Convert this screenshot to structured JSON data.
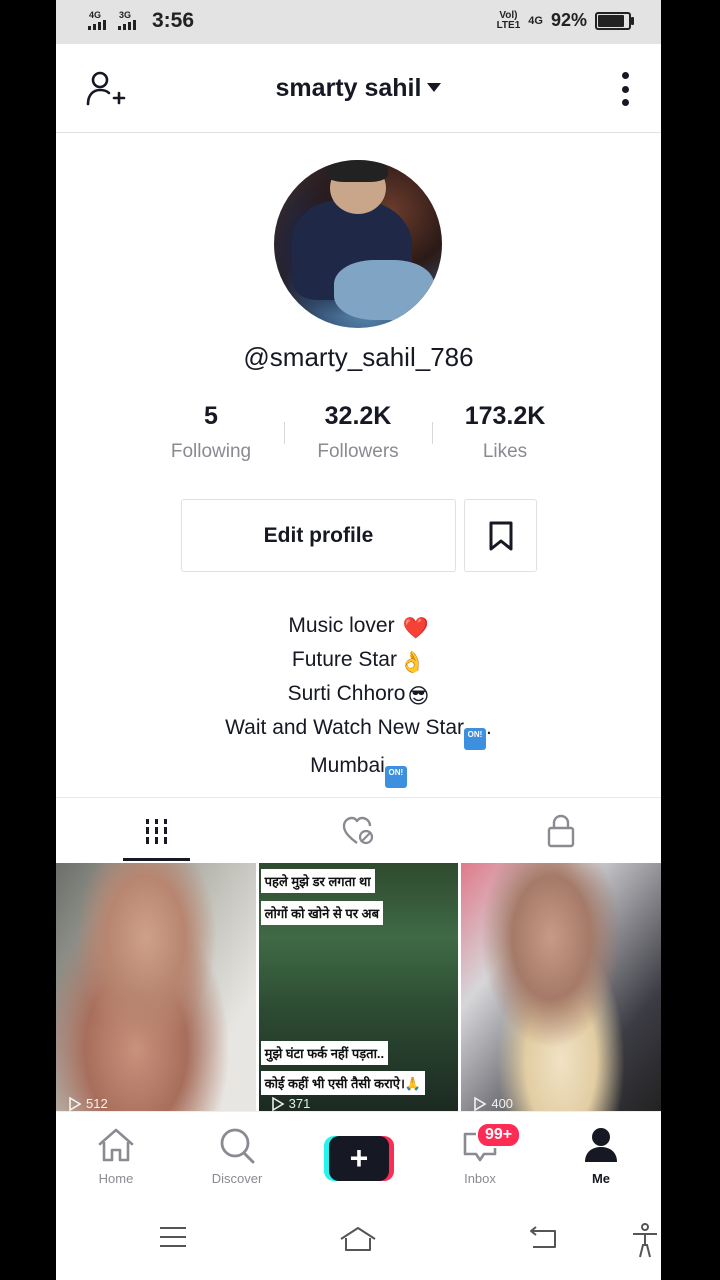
{
  "status_bar": {
    "sim1_network": "4G",
    "sim2_network": "3G",
    "time": "3:56",
    "volte_top": "Vol)",
    "volte_bottom": "LTE1",
    "network_right": "4G",
    "battery_percent_text": "92%",
    "battery_level": 0.92
  },
  "header": {
    "title": "smarty sahil",
    "add_friend_icon": "add-user-icon",
    "more_icon": "vertical-dots-icon"
  },
  "profile": {
    "handle": "@smarty_sahil_786",
    "stats": [
      {
        "value": "5",
        "label": "Following"
      },
      {
        "value": "32.2K",
        "label": "Followers"
      },
      {
        "value": "173.2K",
        "label": "Likes"
      }
    ],
    "edit_button": "Edit profile",
    "bookmark_icon": "bookmark-icon",
    "bio": [
      {
        "text": "Music lover ",
        "emoji": "❤️"
      },
      {
        "text": "Future Star",
        "emoji": "👌"
      },
      {
        "text": "Surti Chhoro",
        "emoji": "😎"
      },
      {
        "text": "Wait and Watch New Star",
        "badge": "ON!",
        "suffix": "."
      },
      {
        "text": "Mumbai",
        "badge": "ON!",
        "suffix": ""
      }
    ],
    "badge_text": "ON!"
  },
  "tabs": [
    {
      "name": "videos-grid-icon",
      "active": true
    },
    {
      "name": "liked-hidden-icon",
      "active": false
    },
    {
      "name": "lock-icon",
      "active": false
    }
  ],
  "videos": [
    {
      "plays": "512",
      "captions": []
    },
    {
      "plays": "371",
      "captions": [
        "पहले मुझे डर लगता था",
        "लोगों को खोने से पर अब",
        "मुझे घंटा फर्क नहीं पड़ता..",
        "कोई कहीं भी एसी तैसी कराऐ।🙏"
      ]
    },
    {
      "plays": "400",
      "captions": []
    }
  ],
  "bottom_nav": {
    "home": "Home",
    "discover": "Discover",
    "create": "+",
    "inbox": "Inbox",
    "inbox_badge": "99+",
    "me": "Me"
  },
  "colors": {
    "text": "#161823",
    "secondary": "#8a8b91",
    "accent_red": "#fe2c55",
    "accent_cyan": "#25f4ee"
  }
}
